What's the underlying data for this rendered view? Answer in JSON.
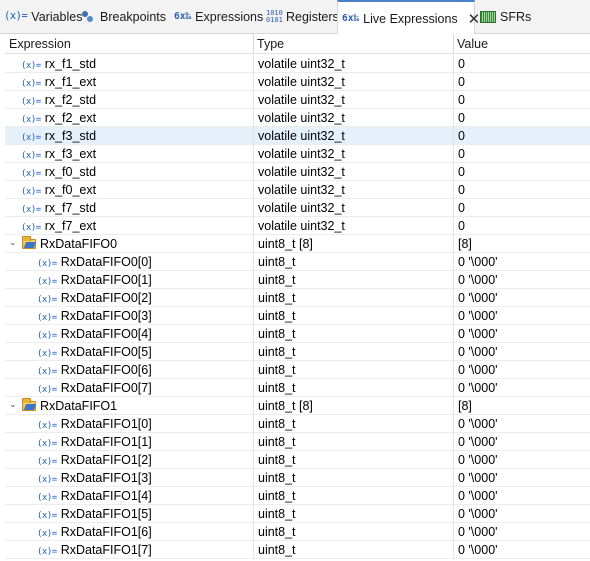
{
  "tabs": [
    {
      "label": "Variables",
      "icon": "variables-icon",
      "glyph": "(x)="
    },
    {
      "label": "Breakpoints",
      "icon": "breakpoints-icon"
    },
    {
      "label": "Expressions",
      "icon": "expressions-icon",
      "glyph": "6x‰"
    },
    {
      "label": "Registers",
      "icon": "registers-icon",
      "glyph": "1010"
    },
    {
      "label": "Live Expressions",
      "icon": "live-expressions-icon",
      "glyph": "6x‰"
    },
    {
      "label": "SFRs",
      "icon": "sfrs-icon"
    }
  ],
  "active_tab_close": "✕",
  "columns": {
    "expression": "Expression",
    "type": "Type",
    "value": "Value"
  },
  "rows": [
    {
      "name": "rx_f1_std",
      "type": "volatile uint32_t",
      "value": "0"
    },
    {
      "name": "rx_f1_ext",
      "type": "volatile uint32_t",
      "value": "0"
    },
    {
      "name": "rx_f2_std",
      "type": "volatile uint32_t",
      "value": "0"
    },
    {
      "name": "rx_f2_ext",
      "type": "volatile uint32_t",
      "value": "0"
    },
    {
      "name": "rx_f3_std",
      "type": "volatile uint32_t",
      "value": "0"
    },
    {
      "name": "rx_f3_ext",
      "type": "volatile uint32_t",
      "value": "0"
    },
    {
      "name": "rx_f0_std",
      "type": "volatile uint32_t",
      "value": "0"
    },
    {
      "name": "rx_f0_ext",
      "type": "volatile uint32_t",
      "value": "0"
    },
    {
      "name": "rx_f7_std",
      "type": "volatile uint32_t",
      "value": "0"
    },
    {
      "name": "rx_f7_ext",
      "type": "volatile uint32_t",
      "value": "0"
    }
  ],
  "selected_row": "rx_f3_std",
  "var_glyph": "(x)=",
  "arrays": [
    {
      "name": "RxDataFIFO0",
      "type": "uint8_t [8]",
      "value": "[8]",
      "expanded": true,
      "children": [
        {
          "name": "RxDataFIFO0[0]",
          "type": "uint8_t",
          "value": "0 '\\000'"
        },
        {
          "name": "RxDataFIFO0[1]",
          "type": "uint8_t",
          "value": "0 '\\000'"
        },
        {
          "name": "RxDataFIFO0[2]",
          "type": "uint8_t",
          "value": "0 '\\000'"
        },
        {
          "name": "RxDataFIFO0[3]",
          "type": "uint8_t",
          "value": "0 '\\000'"
        },
        {
          "name": "RxDataFIFO0[4]",
          "type": "uint8_t",
          "value": "0 '\\000'"
        },
        {
          "name": "RxDataFIFO0[5]",
          "type": "uint8_t",
          "value": "0 '\\000'"
        },
        {
          "name": "RxDataFIFO0[6]",
          "type": "uint8_t",
          "value": "0 '\\000'"
        },
        {
          "name": "RxDataFIFO0[7]",
          "type": "uint8_t",
          "value": "0 '\\000'"
        }
      ]
    },
    {
      "name": "RxDataFIFO1",
      "type": "uint8_t [8]",
      "value": "[8]",
      "expanded": true,
      "children": [
        {
          "name": "RxDataFIFO1[0]",
          "type": "uint8_t",
          "value": "0 '\\000'"
        },
        {
          "name": "RxDataFIFO1[1]",
          "type": "uint8_t",
          "value": "0 '\\000'"
        },
        {
          "name": "RxDataFIFO1[2]",
          "type": "uint8_t",
          "value": "0 '\\000'"
        },
        {
          "name": "RxDataFIFO1[3]",
          "type": "uint8_t",
          "value": "0 '\\000'"
        },
        {
          "name": "RxDataFIFO1[4]",
          "type": "uint8_t",
          "value": "0 '\\000'"
        },
        {
          "name": "RxDataFIFO1[5]",
          "type": "uint8_t",
          "value": "0 '\\000'"
        },
        {
          "name": "RxDataFIFO1[6]",
          "type": "uint8_t",
          "value": "0 '\\000'"
        },
        {
          "name": "RxDataFIFO1[7]",
          "type": "uint8_t",
          "value": "0 '\\000'"
        }
      ]
    }
  ]
}
